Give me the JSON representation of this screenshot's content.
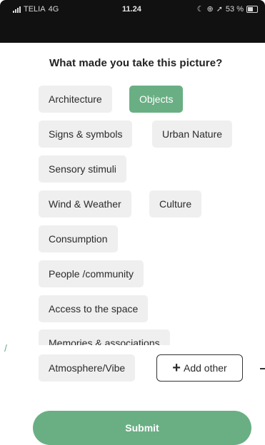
{
  "status_bar": {
    "carrier": "TELIA",
    "network": "4G",
    "time": "11.24",
    "battery": "53 %"
  },
  "question": "What made you take this picture?",
  "chips": [
    {
      "label": "Architecture",
      "selected": false
    },
    {
      "label": "Objects",
      "selected": true
    },
    {
      "label": "Signs & symbols",
      "selected": false
    },
    {
      "label": "Urban Nature",
      "selected": false
    },
    {
      "label": "Sensory stimuli",
      "selected": false
    },
    {
      "label": "Wind & Weather",
      "selected": false
    },
    {
      "label": "Culture",
      "selected": false
    },
    {
      "label": "Consumption",
      "selected": false
    },
    {
      "label": "People /community",
      "selected": false
    },
    {
      "label": "Access to the space",
      "selected": false
    },
    {
      "label": "Memories & associations",
      "selected": false
    },
    {
      "label": "Atmosphere/Vibe",
      "selected": false
    }
  ],
  "add_other": "Add other",
  "submit": "Submit",
  "colors": {
    "accent": "#6aaf84",
    "chip_bg": "#efefef",
    "status_bar_bg": "#111111"
  },
  "icons": {
    "add": "plus-icon",
    "signal": "signal-icon",
    "battery": "battery-icon"
  }
}
